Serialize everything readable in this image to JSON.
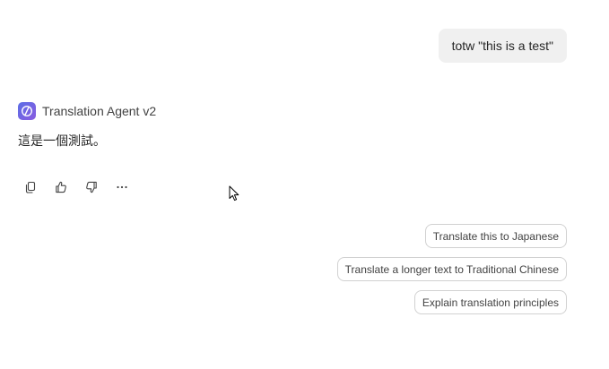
{
  "user_message": "totw \"this is a test\"",
  "agent": {
    "name": "Translation Agent v2",
    "icon": "slash-circle-icon",
    "accent": "#6366e8"
  },
  "agent_message": "這是一個測試。",
  "actions": [
    {
      "icon": "copy-icon"
    },
    {
      "icon": "thumbs-up-icon"
    },
    {
      "icon": "thumbs-down-icon"
    },
    {
      "icon": "more-icon"
    }
  ],
  "suggestions": [
    {
      "label": "Translate this to Japanese"
    },
    {
      "label": "Translate a longer text to Traditional Chinese"
    },
    {
      "label": "Explain translation principles"
    }
  ]
}
